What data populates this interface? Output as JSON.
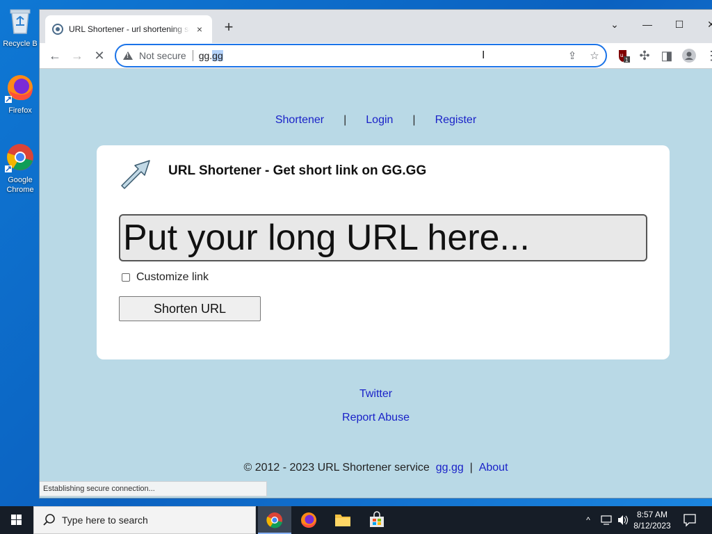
{
  "desktop": {
    "icons": [
      {
        "label": "Recycle Bin",
        "visible_label": "Recycle B"
      },
      {
        "label": "Firefox",
        "visible_label": "Firefox"
      },
      {
        "label": "Google Chrome",
        "line1": "Google",
        "line2": "Chrome"
      }
    ]
  },
  "browser": {
    "tab_title": "URL Shortener - url shortening service",
    "tab_close": "×",
    "new_tab": "+",
    "window_controls": {
      "minimize": "—",
      "maximize": "☐",
      "close": "✕",
      "tabsearch": "⌄"
    },
    "address": {
      "security_label": "Not secure",
      "host_prefix": "gg.",
      "host_selected": "gg"
    },
    "status_text": "Establishing secure connection...",
    "extension_badge": "1"
  },
  "page": {
    "nav": {
      "shortener": "Shortener",
      "login": "Login",
      "register": "Register",
      "separator": "|"
    },
    "card_title": "URL Shortener - Get short link on GG.GG",
    "url_placeholder": "Put your long URL here...",
    "customize_label": "Customize link",
    "shorten_button": "Shorten URL",
    "footer": {
      "twitter": "Twitter",
      "report_abuse": "Report Abuse",
      "copyright": "© 2012 - 2023 URL Shortener service",
      "site_link": "gg.gg",
      "separator": "|",
      "about": "About"
    }
  },
  "taskbar": {
    "search_placeholder": "Type here to search",
    "clock_time": "8:57 AM",
    "clock_date": "8/12/2023"
  },
  "colors": {
    "page_bg": "#b9d9e6",
    "link": "#1a22c8",
    "accent": "#1a73e8"
  }
}
